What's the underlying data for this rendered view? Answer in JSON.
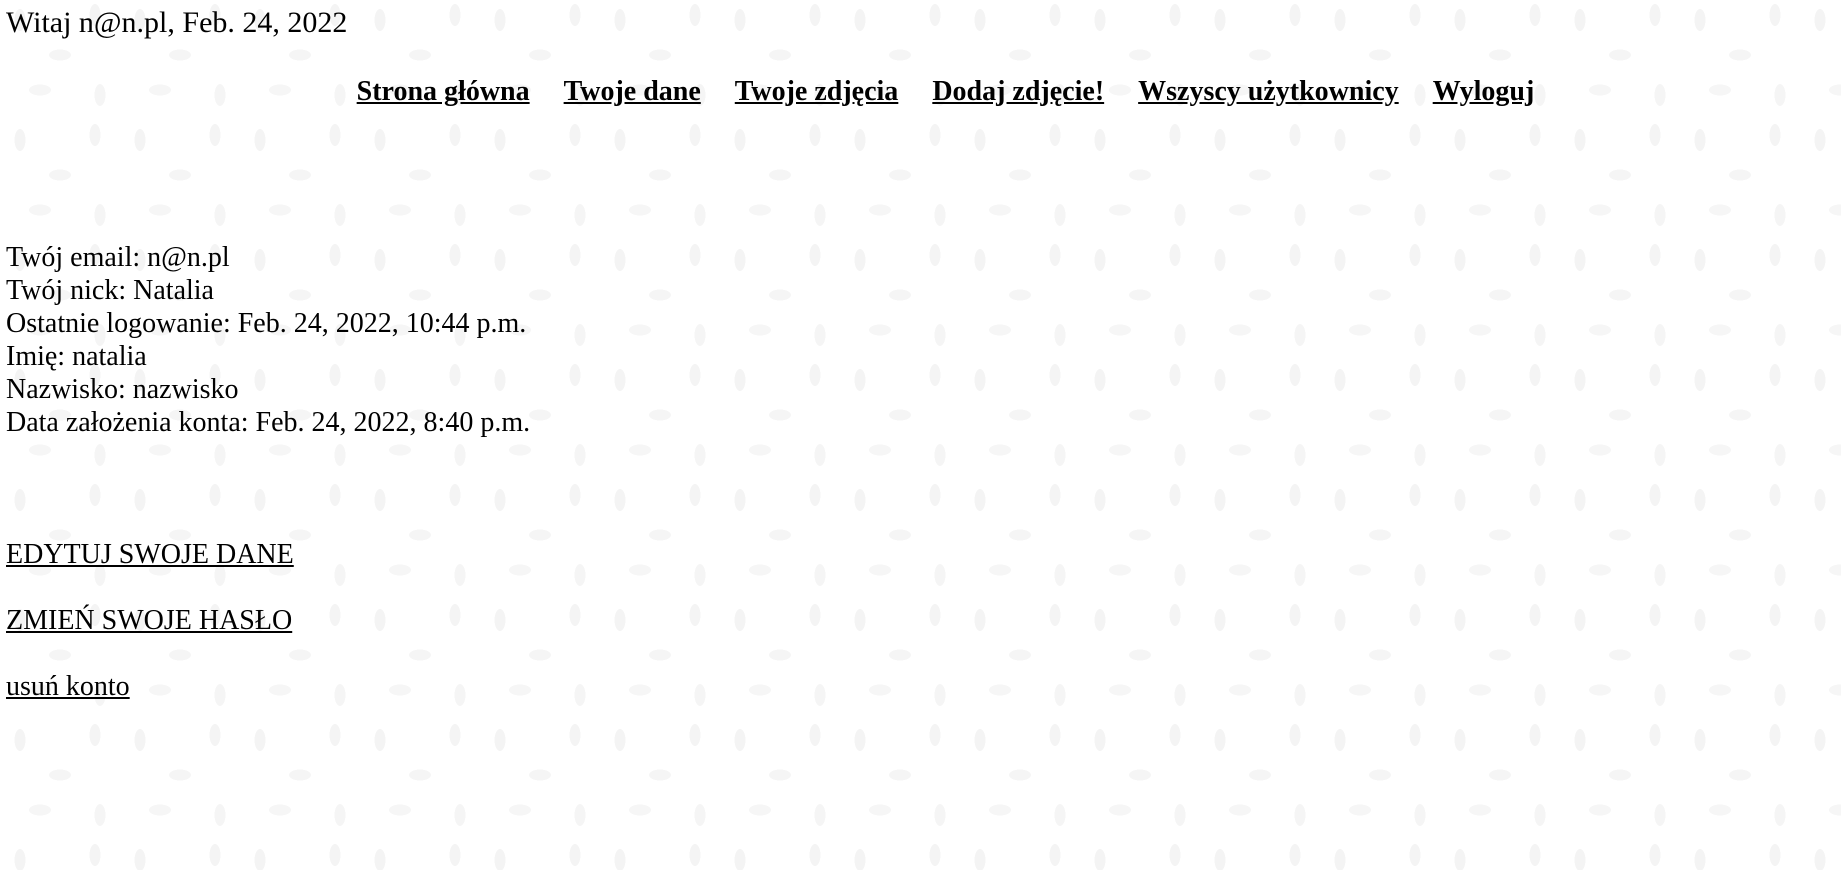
{
  "header": {
    "greeting": "Witaj n@n.pl, Feb. 24, 2022"
  },
  "nav": {
    "items": [
      {
        "label": "Strona główna"
      },
      {
        "label": "Twoje dane"
      },
      {
        "label": "Twoje zdjęcia"
      },
      {
        "label": "Dodaj zdjęcie!"
      },
      {
        "label": "Wszyscy użytkownicy"
      },
      {
        "label": "Wyloguj"
      }
    ]
  },
  "profile": {
    "email": "Twój email: n@n.pl",
    "nick": "Twój nick: Natalia",
    "last_login": "Ostatnie logowanie: Feb. 24, 2022, 10:44 p.m.",
    "first_name": "Imię: natalia",
    "last_name": "Nazwisko: nazwisko",
    "created": "Data założenia konta: Feb. 24, 2022, 8:40 p.m."
  },
  "actions": {
    "edit_label": "EDYTUJ SWOJE DANE",
    "change_password_label": "ZMIEŃ SWOJE HASŁO",
    "delete_account_label": "usuń konto"
  },
  "colors": {
    "text": "#000000",
    "background": "#ffffff"
  }
}
